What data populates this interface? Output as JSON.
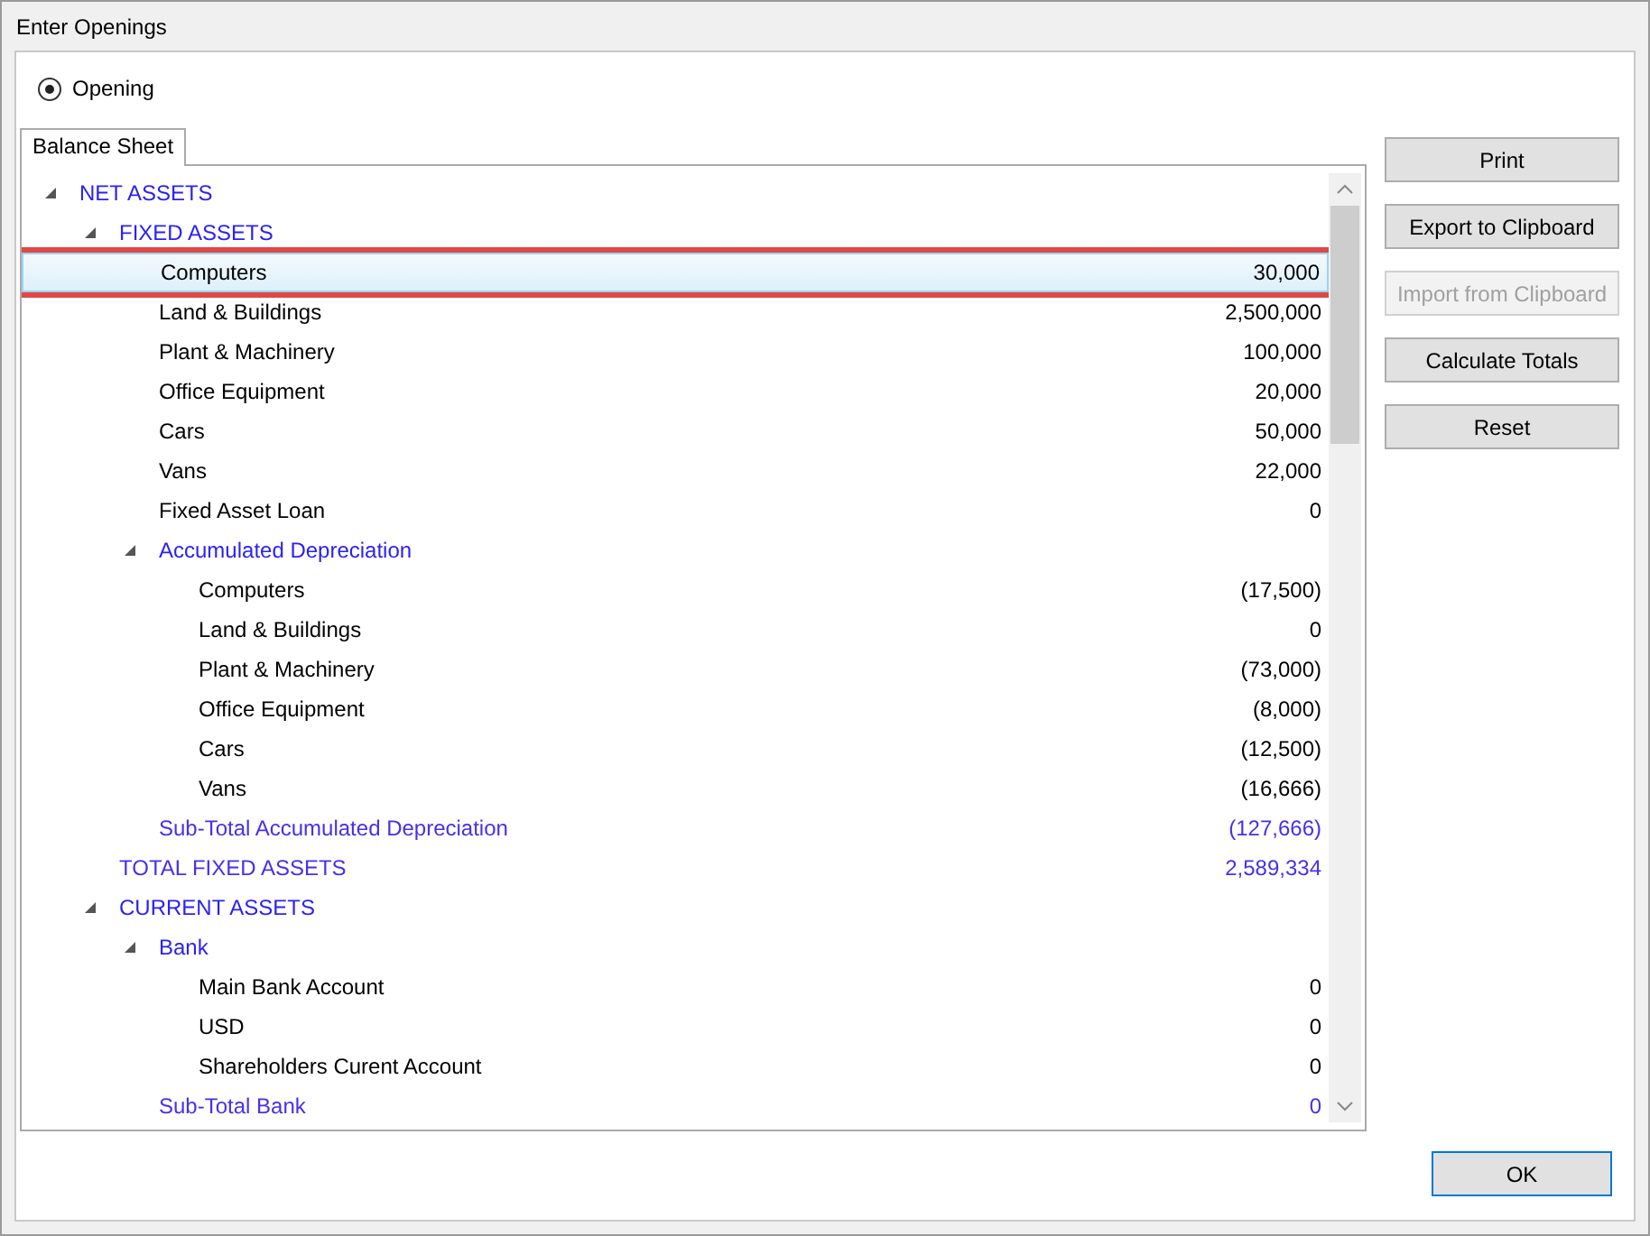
{
  "window": {
    "title": "Enter Openings"
  },
  "mode": {
    "label": "Opening",
    "selected": true
  },
  "tabs": [
    {
      "label": "Balance Sheet",
      "selected": true
    }
  ],
  "tree": [
    {
      "label": "NET ASSETS",
      "kind": "group",
      "expanded": true,
      "selected": false,
      "children": [
        {
          "label": "FIXED ASSETS",
          "kind": "group",
          "expanded": true,
          "selected": false,
          "children": [
            {
              "label": "Computers",
              "kind": "account",
              "value": "30,000",
              "selected": true
            },
            {
              "label": "Land & Buildings",
              "kind": "account",
              "value": "2,500,000",
              "selected": false
            },
            {
              "label": "Plant & Machinery",
              "kind": "account",
              "value": "100,000",
              "selected": false
            },
            {
              "label": "Office Equipment",
              "kind": "account",
              "value": "20,000",
              "selected": false
            },
            {
              "label": "Cars",
              "kind": "account",
              "value": "50,000",
              "selected": false
            },
            {
              "label": "Vans",
              "kind": "account",
              "value": "22,000",
              "selected": false
            },
            {
              "label": "Fixed Asset Loan",
              "kind": "account",
              "value": "0",
              "selected": false
            },
            {
              "label": "Accumulated Depreciation",
              "kind": "group",
              "expanded": true,
              "selected": false,
              "children": [
                {
                  "label": "Computers",
                  "kind": "account",
                  "value": "(17,500)",
                  "selected": false
                },
                {
                  "label": "Land & Buildings",
                  "kind": "account",
                  "value": "0",
                  "selected": false
                },
                {
                  "label": "Plant & Machinery",
                  "kind": "account",
                  "value": "(73,000)",
                  "selected": false
                },
                {
                  "label": "Office Equipment",
                  "kind": "account",
                  "value": "(8,000)",
                  "selected": false
                },
                {
                  "label": "Cars",
                  "kind": "account",
                  "value": "(12,500)",
                  "selected": false
                },
                {
                  "label": "Vans",
                  "kind": "account",
                  "value": "(16,666)",
                  "selected": false
                }
              ]
            },
            {
              "label": "Sub-Total Accumulated Depreciation",
              "kind": "total",
              "value": "(127,666)",
              "selected": false
            }
          ]
        },
        {
          "label": "TOTAL FIXED ASSETS",
          "kind": "total",
          "value": "2,589,334",
          "selected": false
        },
        {
          "label": "CURRENT ASSETS",
          "kind": "group",
          "expanded": true,
          "selected": false,
          "children": [
            {
              "label": "Bank",
              "kind": "group",
              "expanded": true,
              "selected": false,
              "children": [
                {
                  "label": "Main Bank Account",
                  "kind": "account",
                  "value": "0",
                  "selected": false
                },
                {
                  "label": "USD",
                  "kind": "account",
                  "value": "0",
                  "selected": false
                },
                {
                  "label": "Shareholders Curent Account",
                  "kind": "account",
                  "value": "0",
                  "selected": false
                }
              ]
            },
            {
              "label": "Sub-Total Bank",
              "kind": "total",
              "value": "0",
              "selected": false
            }
          ]
        }
      ]
    }
  ],
  "actions": [
    {
      "label": "Print",
      "disabled": false
    },
    {
      "label": "Export to Clipboard",
      "disabled": false
    },
    {
      "label": "Import from Clipboard",
      "disabled": true
    },
    {
      "label": "Calculate Totals",
      "disabled": false
    },
    {
      "label": "Reset",
      "disabled": false
    }
  ],
  "footer": {
    "ok": "OK"
  }
}
